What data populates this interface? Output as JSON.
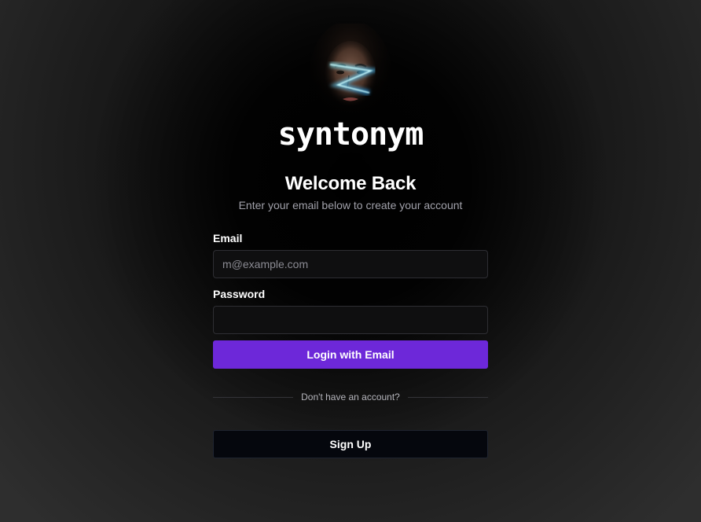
{
  "brand": {
    "logo_text": "syntonym",
    "hero_image": "portrait-with-blue-light-streak",
    "accent_color": "#6d28d9"
  },
  "header": {
    "title": "Welcome Back",
    "subtitle": "Enter your email below to create your account"
  },
  "form": {
    "email_label": "Email",
    "email_placeholder": "m@example.com",
    "email_value": "",
    "password_label": "Password",
    "password_value": "",
    "login_button": "Login with Email"
  },
  "divider": {
    "text": "Don't have an account?"
  },
  "signup": {
    "button": "Sign Up"
  }
}
